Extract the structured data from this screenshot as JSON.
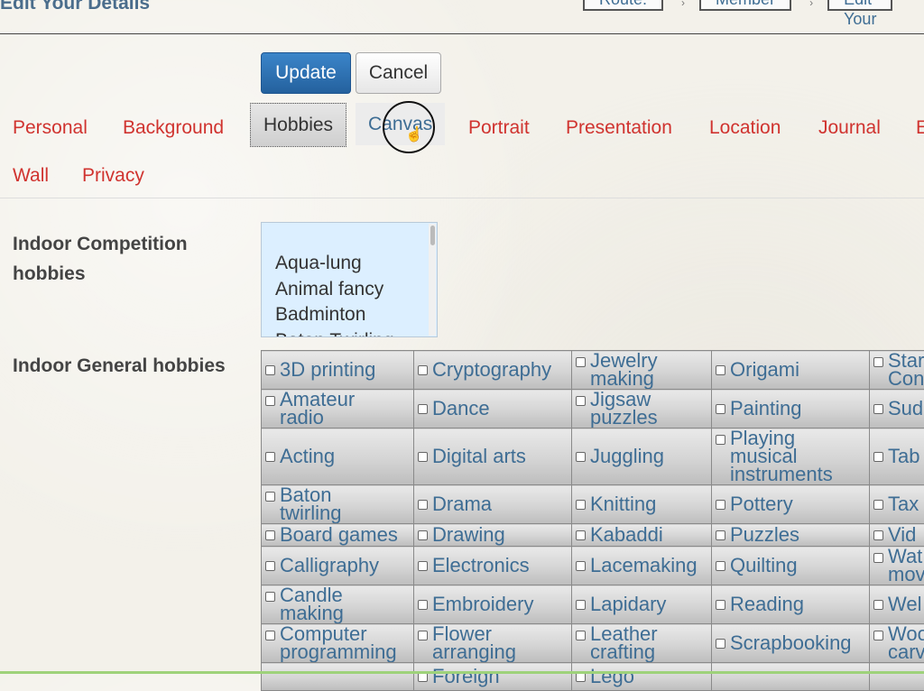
{
  "header": {
    "title": "Edit Your Details",
    "breadcrumbs": [
      "Route:",
      "Member",
      "Edit Your"
    ]
  },
  "actions": {
    "update": "Update",
    "cancel": "Cancel"
  },
  "tabs": {
    "row1": [
      "Personal",
      "Background",
      "Hobbies",
      "Canvas",
      "Portrait",
      "Presentation",
      "Location",
      "Journal",
      "E"
    ],
    "row2": [
      "Wall",
      "Privacy"
    ],
    "active": "Hobbies",
    "hovered": "Canvas"
  },
  "indoor_competition": {
    "label": "Indoor Competition hobbies",
    "options": [
      "Aqua-lung",
      "Animal fancy",
      "Badminton",
      "Baton Twirling"
    ]
  },
  "indoor_general": {
    "label": "Indoor General hobbies",
    "rows": [
      [
        [
          "3D printing"
        ],
        [
          "Cryptography"
        ],
        [
          "Jewelry",
          "making"
        ],
        [
          "Origami"
        ],
        [
          "Star",
          "Con"
        ]
      ],
      [
        [
          "Amateur",
          "radio"
        ],
        [
          "Dance"
        ],
        [
          "Jigsaw",
          "puzzles"
        ],
        [
          "Painting"
        ],
        [
          "Sud"
        ]
      ],
      [
        [
          "Acting"
        ],
        [
          "Digital arts"
        ],
        [
          "Juggling"
        ],
        [
          "Playing",
          "musical",
          "instruments"
        ],
        [
          "Tab"
        ]
      ],
      [
        [
          "Baton",
          "twirling"
        ],
        [
          "Drama"
        ],
        [
          "Knitting"
        ],
        [
          "Pottery"
        ],
        [
          "Tax"
        ]
      ],
      [
        [
          "Board games"
        ],
        [
          "Drawing"
        ],
        [
          "Kabaddi"
        ],
        [
          "Puzzles"
        ],
        [
          "Vid"
        ]
      ],
      [
        [
          "Calligraphy"
        ],
        [
          "Electronics"
        ],
        [
          "Lacemaking"
        ],
        [
          "Quilting"
        ],
        [
          "Wat",
          "mov"
        ]
      ],
      [
        [
          "Candle",
          "making"
        ],
        [
          "Embroidery"
        ],
        [
          "Lapidary"
        ],
        [
          "Reading"
        ],
        [
          "Wel"
        ]
      ],
      [
        [
          "Computer",
          "programming"
        ],
        [
          "Flower",
          "arranging"
        ],
        [
          "Leather",
          "crafting"
        ],
        [
          "Scrapbooking"
        ],
        [
          "Woo",
          "carv"
        ]
      ],
      [
        [
          ""
        ],
        [
          "Foreign"
        ],
        [
          "Lego"
        ],
        [
          ""
        ],
        [
          ""
        ]
      ]
    ]
  }
}
